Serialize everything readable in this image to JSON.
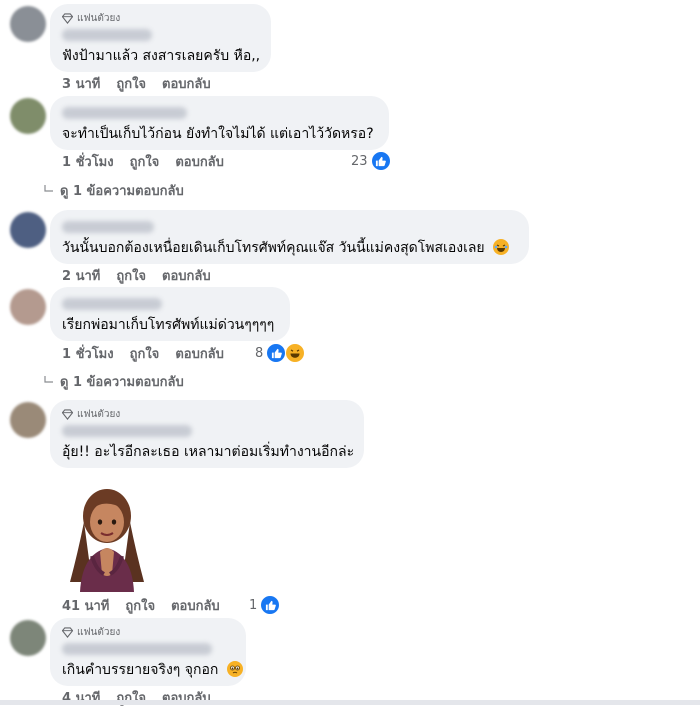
{
  "badge_label": "แฟนตัวยง",
  "actions": {
    "like": "ถูกใจ",
    "reply": "ตอบกลับ"
  },
  "colors": {
    "bubble": "#f0f2f5",
    "meta": "#65676b",
    "like_blue": "#1877f2",
    "laugh_yellow": "#f7b125"
  },
  "comments": [
    {
      "id": "c1",
      "fan_badge": true,
      "text": "ฟังป้ามาแล้ว สงสารเลยครับ หือ,,",
      "time": "3 นาที"
    },
    {
      "id": "c2",
      "fan_badge": false,
      "text": "จะทำเป็นเก็บไว้ก่อน ยังทำใจไม่ได้ แต่เอาไว้วัดหรอ?",
      "time": "1 ชั่วโมง",
      "reaction_count": "23",
      "reactions": [
        "like-icon"
      ],
      "replies_link": "ดู 1 ข้อความตอบกลับ"
    },
    {
      "id": "c3",
      "fan_badge": false,
      "text": "วันนั้นบอกต้องเหนื่อยเดินเก็บโทรศัพท์คุณแจ๊ส วันนี้แม่คงสุดโพสเองเลย",
      "time": "2 นาที",
      "emoji": "laughing-emoji-icon"
    },
    {
      "id": "c4",
      "fan_badge": false,
      "text": "เรียกพ่อมาเก็บโทรศัพท์แม่ด่วนๆๆๆๆ",
      "time": "1 ชั่วโมง",
      "reaction_count": "8",
      "reactions": [
        "like-icon",
        "laugh-icon"
      ],
      "replies_link": "ดู 1 ข้อความตอบกลับ"
    },
    {
      "id": "c5",
      "fan_badge": true,
      "text": "อุ้ย!! อะไรอีกละเธอ เหลามาต่อมเริ่มทำงานอีกล่ะ",
      "time": "41 นาที",
      "reaction_count": "1",
      "reactions": [
        "like-icon"
      ],
      "sticker": "praying-woman-sticker"
    },
    {
      "id": "c6",
      "fan_badge": true,
      "text": "เกินคำบรรยายจริงๆ จุกอก",
      "time": "4 นาที",
      "emoji": "teary-emoji-icon"
    }
  ]
}
